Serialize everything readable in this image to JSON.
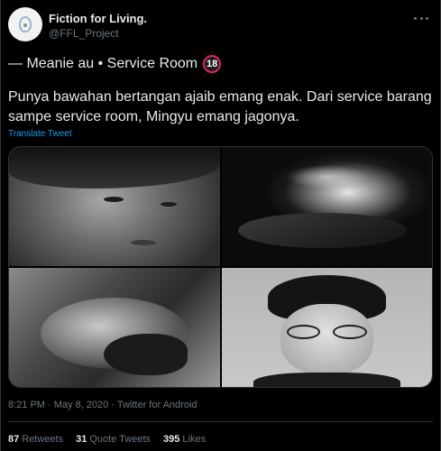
{
  "account": {
    "name": "Fiction for Living.",
    "handle": "@FFL_Project"
  },
  "tweet": {
    "title": "— Meanie au • Service Room",
    "badge": "18",
    "body": "Punya bawahan bertangan ajaib emang enak. Dari service barang sampe service room, Mingyu emang jagonya.",
    "translate_label": "Translate Tweet",
    "meta": "8:21 PM · May 8, 2020 · Twitter for Android"
  },
  "media": {
    "photos": [
      "photo-1",
      "photo-2",
      "photo-3",
      "photo-4"
    ]
  },
  "stats": {
    "retweets_count": "87",
    "retweets_label": "Retweets",
    "quotes_count": "31",
    "quotes_label": "Quote Tweets",
    "likes_count": "395",
    "likes_label": "Likes"
  },
  "colors": {
    "background": "#000000",
    "link": "#1d9bf0",
    "muted": "#6e767d",
    "badge_border": "#e0245e"
  }
}
